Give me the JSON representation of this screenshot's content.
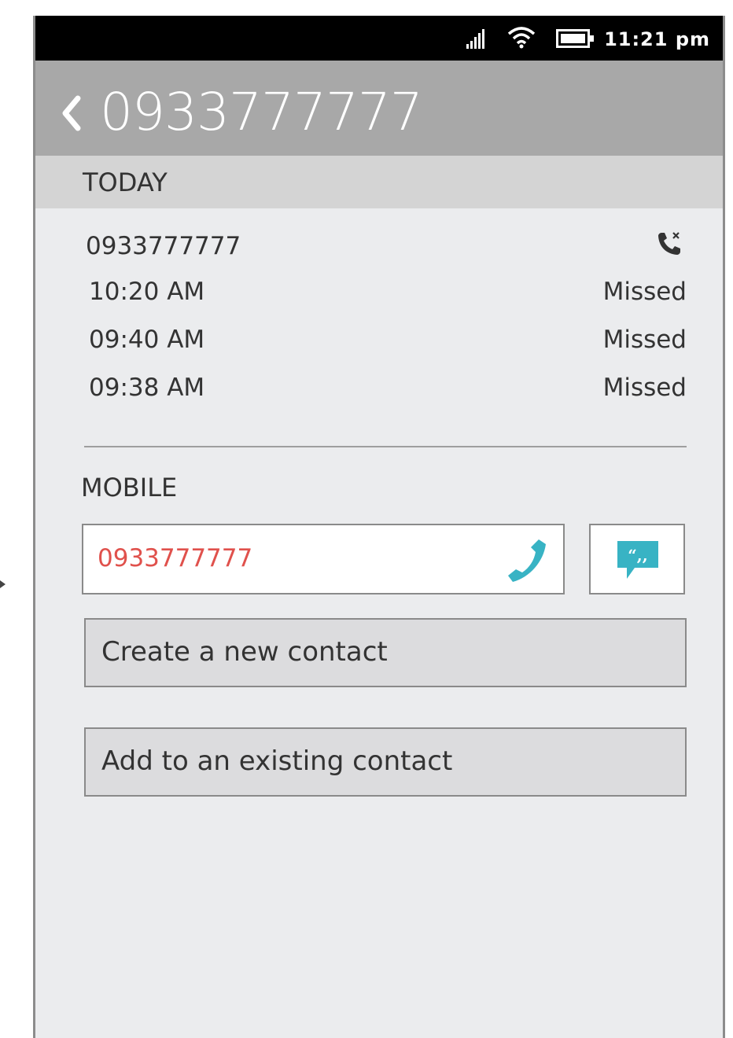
{
  "status_bar": {
    "time": "11:21 pm",
    "icons": [
      "signal-icon",
      "wifi-icon",
      "battery-icon"
    ]
  },
  "header": {
    "back_icon": "chevron-left-icon",
    "title": "0933777777"
  },
  "today_section": {
    "label": "TODAY"
  },
  "call_log": {
    "number": "0933777777",
    "type_icon": "missed-call-icon",
    "entries": [
      {
        "time": "10:20 AM",
        "status": "Missed"
      },
      {
        "time": "09:40 AM",
        "status": "Missed"
      },
      {
        "time": "09:38 AM",
        "status": "Missed"
      }
    ]
  },
  "mobile_section": {
    "label": "MOBILE",
    "number": "0933777777",
    "call_icon": "phone-icon",
    "sms_icon": "message-icon"
  },
  "actions": {
    "create_contact": "Create a new contact",
    "add_existing": "Add to an existing contact"
  },
  "colors": {
    "header_bg": "#a8a8a8",
    "section_bg": "#d4d4d4",
    "page_bg": "#ebecee",
    "accent_teal": "#38b3c4",
    "number_red": "#e0514c"
  }
}
